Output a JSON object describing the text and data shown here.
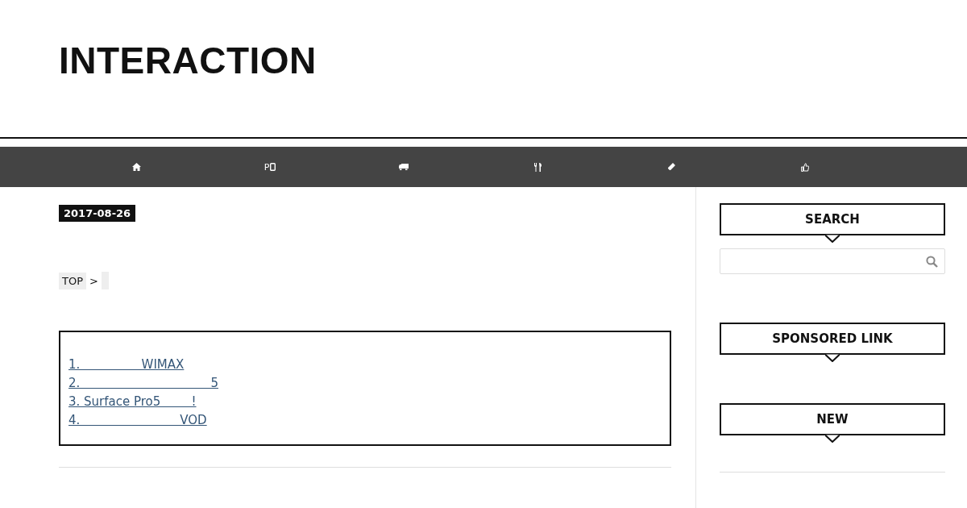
{
  "site_title": "INTERACTION",
  "nav": [
    {
      "kind": "home"
    },
    {
      "kind": "phone",
      "label": "P"
    },
    {
      "kind": "truck"
    },
    {
      "kind": "cutlery"
    },
    {
      "kind": "pencil"
    },
    {
      "kind": "thumb"
    }
  ],
  "post": {
    "date": "2017-08-26",
    "breadcrumb": [
      "TOP",
      ">"
    ],
    "toc": [
      "1.                WIMAX",
      "2.                                  5",
      "3. Surface Pro5        !",
      "4.                          VOD"
    ]
  },
  "sidebar": {
    "widgets": [
      {
        "kind": "search",
        "title": "SEARCH"
      },
      {
        "kind": "plain",
        "title": "SPONSORED LINK"
      },
      {
        "kind": "plain",
        "title": "NEW"
      }
    ]
  }
}
